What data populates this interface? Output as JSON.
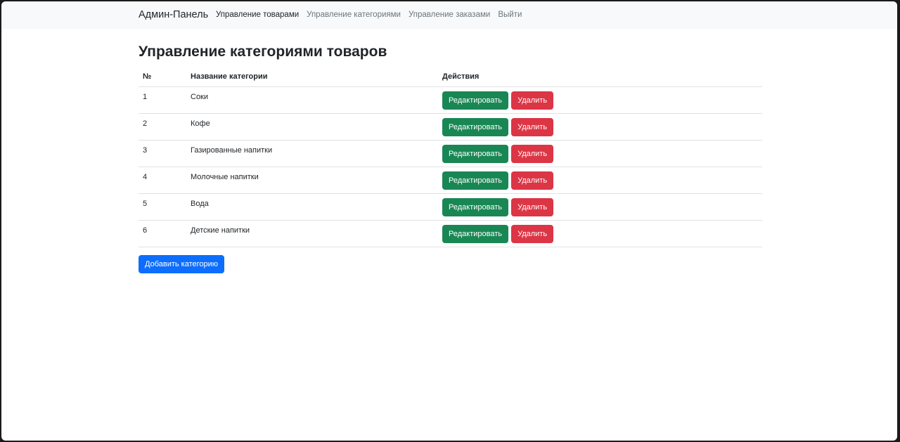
{
  "navbar": {
    "brand": "Админ-Панель",
    "links": [
      {
        "label": "Управление товарами",
        "active": true
      },
      {
        "label": "Управление категориями",
        "active": false
      },
      {
        "label": "Управление заказами",
        "active": false
      },
      {
        "label": "Выйти",
        "active": false
      }
    ]
  },
  "page": {
    "title": "Управление категориями товаров"
  },
  "table": {
    "headers": [
      "№",
      "Название категории",
      "Действия"
    ],
    "rows": [
      {
        "num": "1",
        "name": "Соки"
      },
      {
        "num": "2",
        "name": "Кофе"
      },
      {
        "num": "3",
        "name": "Газированные напитки"
      },
      {
        "num": "4",
        "name": "Молочные напитки"
      },
      {
        "num": "5",
        "name": "Вода"
      },
      {
        "num": "6",
        "name": "Детские напитки"
      }
    ],
    "edit_label": "Редактировать",
    "delete_label": "Удалить"
  },
  "add_button_label": "Добавить категорию",
  "colors": {
    "success": "#198754",
    "danger": "#dc3545",
    "primary": "#0d6efd",
    "navbar_bg": "#f8f9fa"
  }
}
